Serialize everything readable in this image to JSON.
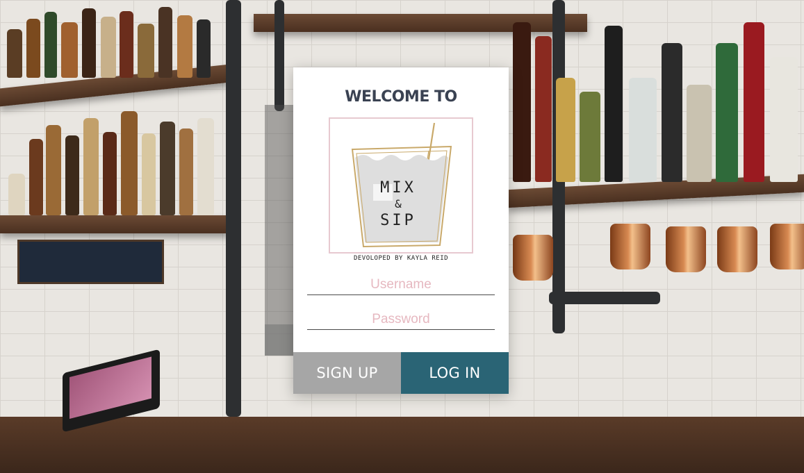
{
  "login": {
    "title": "WELCOME TO",
    "logo": {
      "line1": "MIX",
      "line2": "&",
      "line3": "SIP"
    },
    "credit": "DEVOLOPED BY KAYLA REID",
    "username_placeholder": "Username",
    "password_placeholder": "Password",
    "signup_label": "SIGN UP",
    "login_label": "LOG IN"
  },
  "colors": {
    "title": "#3a4252",
    "signup_bg": "#a6a6a6",
    "login_bg": "#2a6475",
    "placeholder": "#e6b8c0",
    "logo_frame": "#e7c9d0",
    "logo_glass": "#c9a96a"
  },
  "background": {
    "icon": "bar-shelves-photo"
  }
}
